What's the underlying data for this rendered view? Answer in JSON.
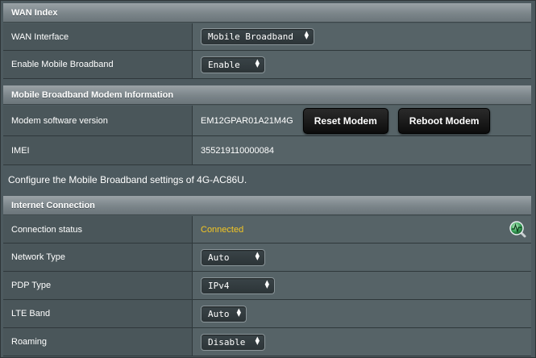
{
  "wan_index": {
    "header": "WAN Index",
    "wan_interface": {
      "label": "WAN Interface",
      "value": "Mobile Broadband"
    },
    "enable_mobile_broadband": {
      "label": "Enable Mobile Broadband",
      "value": "Enable"
    }
  },
  "modem_info": {
    "header": "Mobile Broadband Modem Information",
    "software_version": {
      "label": "Modem software version",
      "value": "EM12GPAR01A21M4G"
    },
    "reset_button": "Reset Modem",
    "reboot_button": "Reboot Modem",
    "imei": {
      "label": "IMEI",
      "value": "355219110000084"
    }
  },
  "description": "Configure the Mobile Broadband settings of 4G-AC86U.",
  "internet_connection": {
    "header": "Internet Connection",
    "connection_status": {
      "label": "Connection status",
      "value": "Connected",
      "color": "#f3c623"
    },
    "network_type": {
      "label": "Network Type",
      "value": "Auto"
    },
    "pdp_type": {
      "label": "PDP Type",
      "value": "IPv4"
    },
    "lte_band": {
      "label": "LTE Band",
      "value": "Auto"
    },
    "roaming": {
      "label": "Roaming",
      "value": "Disable"
    }
  },
  "icons": {
    "status_monitor": "network-status-icon"
  }
}
